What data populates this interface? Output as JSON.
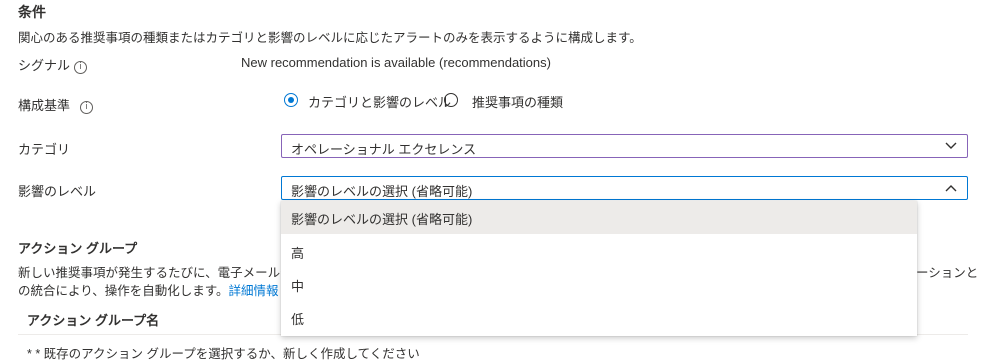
{
  "conditions": {
    "heading": "条件",
    "description": "関心のある推奨事項の種類またはカテゴリと影響のレベルに応じたアラートのみを表示するように構成します。"
  },
  "signal": {
    "label": "シグナル",
    "info_glyph": "i",
    "value": "New recommendation is available (recommendations)"
  },
  "configure_by": {
    "label": "構成基準",
    "info_glyph": "i",
    "options": [
      {
        "label": "カテゴリと影響のレベル",
        "selected": true
      },
      {
        "label": "推奨事項の種類",
        "selected": false
      }
    ]
  },
  "category": {
    "label": "カテゴリ",
    "value": "オペレーショナル エクセレンス"
  },
  "impact": {
    "label": "影響のレベル",
    "value": "影響のレベルの選択 (省略可能)",
    "expanded": true,
    "options": [
      {
        "label": "影響のレベルの選択 (省略可能)",
        "highlighted": true
      },
      {
        "label": "高",
        "highlighted": false
      },
      {
        "label": "中",
        "highlighted": false
      },
      {
        "label": "低",
        "highlighted": false
      }
    ]
  },
  "action_groups": {
    "heading": "アクション グループ",
    "desc_line1_left": "新しい推奨事項が発生するたびに、電子メールや",
    "desc_line1_right": "ーションと",
    "desc_line2_text": "の統合により、操作を自動化します。",
    "desc_link": "詳細情報",
    "column_header": "アクション グループ名",
    "hint": "* * 既存のアクション グループを選択するか、新しく作成してください"
  },
  "colors": {
    "accent": "#0078d4",
    "focus_purple": "#8764b8",
    "text": "#323130"
  },
  "icons": [
    "info-icon",
    "radio-selected",
    "radio-unselected",
    "chevron-down-icon",
    "chevron-up-icon"
  ]
}
